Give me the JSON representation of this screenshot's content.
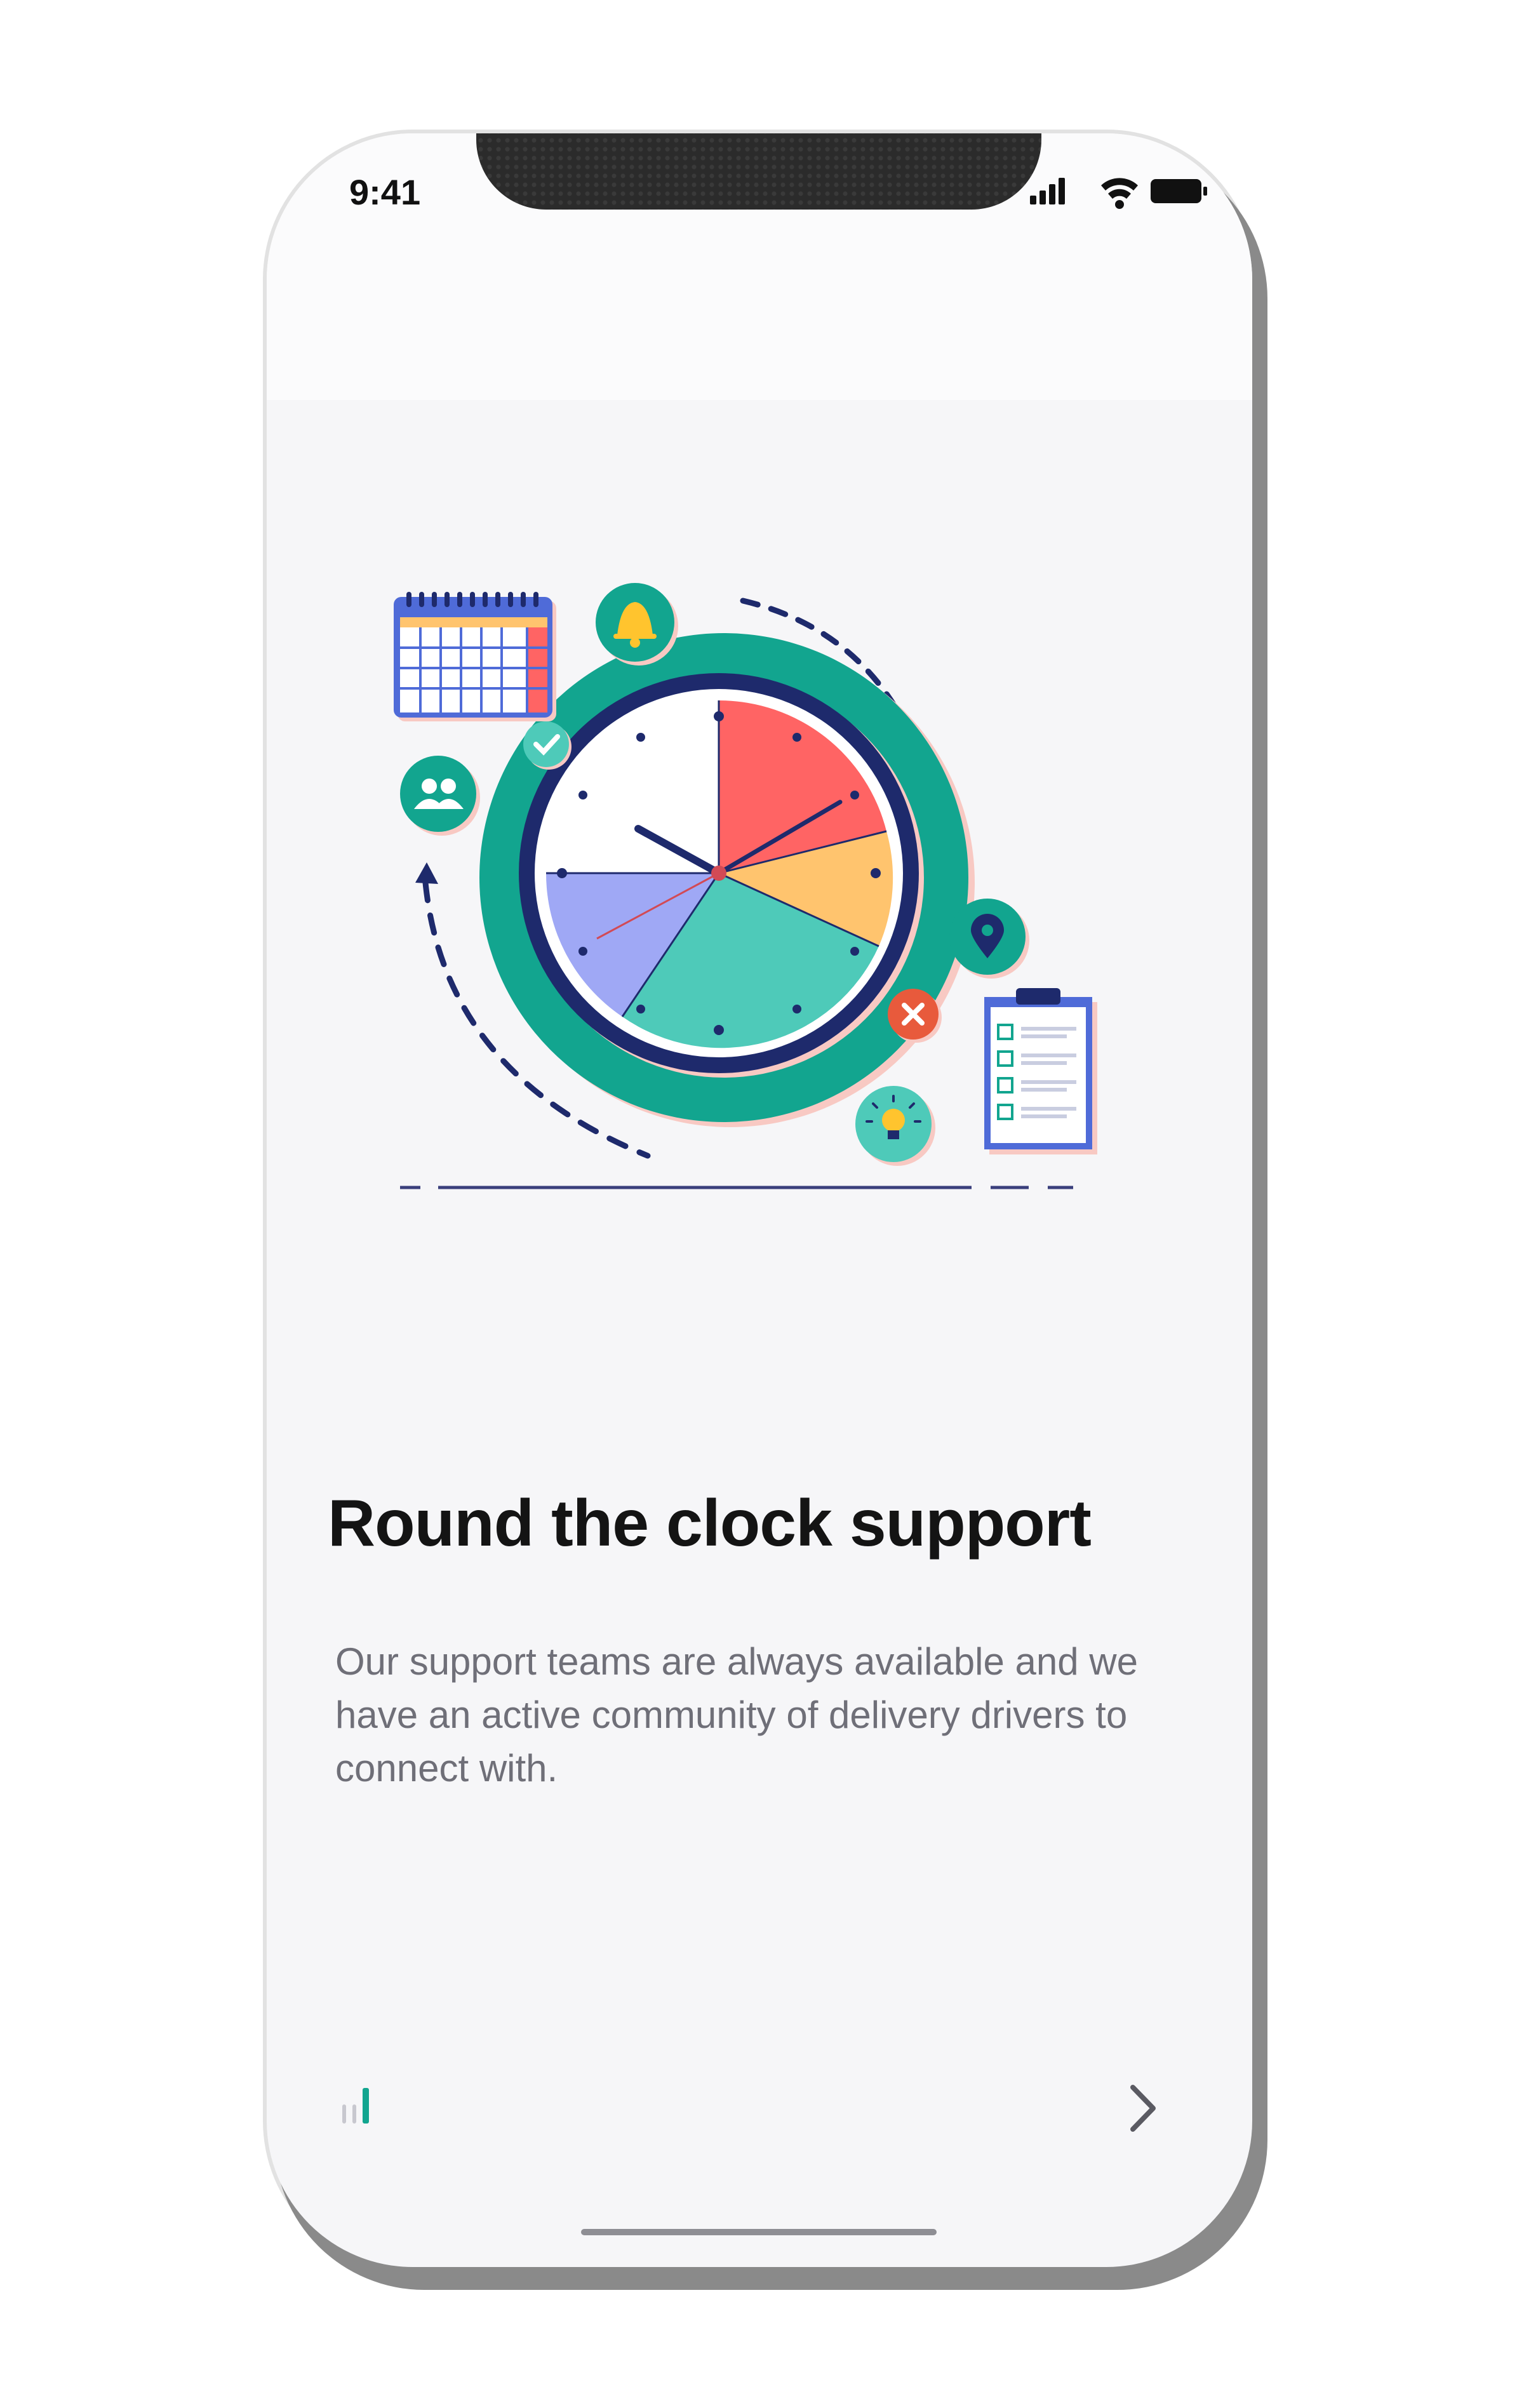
{
  "status_bar": {
    "time": "9:41",
    "icons": [
      "signal-icon",
      "wifi-icon",
      "battery-icon"
    ]
  },
  "onboarding": {
    "title": "Round the clock support",
    "description": "Our support teams are always available and we have an active community of delivery drivers to connect with.",
    "page_count": 3,
    "active_page": 3,
    "next_icon": "chevron-right-icon"
  },
  "colors": {
    "accent": "#12a58f",
    "title": "#141414",
    "description": "#6f6f78",
    "clock_red": "#ff6464",
    "clock_yellow": "#ffc46e",
    "clock_teal": "#4ecab9",
    "clock_blue": "#9fa8f5",
    "navy": "#1e2a6c"
  }
}
